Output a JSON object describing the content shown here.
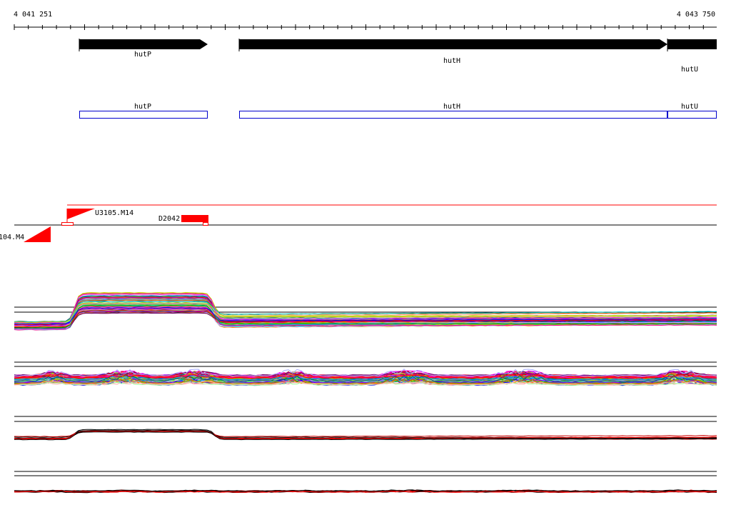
{
  "coordinates": {
    "start_label": "4 041 251",
    "end_label": "4 043 750"
  },
  "genes": [
    {
      "label": "hutP",
      "color": "#000000"
    },
    {
      "label": "hutH",
      "color": "#000000"
    },
    {
      "label": "hutU",
      "color": "#000000"
    }
  ],
  "gene_boxes": [
    {
      "label": "hutP",
      "color": "#0000cc"
    },
    {
      "label": "hutH",
      "color": "#0000cc"
    },
    {
      "label": "hutU",
      "color": "#0000cc"
    }
  ],
  "promoters": [
    {
      "label": "U3105.M14",
      "color": "#ff0000"
    },
    {
      "label": "D2042",
      "color": "#ff0000"
    },
    {
      "label": "104.M4",
      "color": "#ff0000"
    }
  ],
  "expression_tracks": [
    {
      "name": "tiling-track-1"
    },
    {
      "name": "tiling-track-2"
    },
    {
      "name": "tiling-track-3"
    },
    {
      "name": "tiling-track-4"
    }
  ],
  "palette": [
    "#ff0000",
    "#00aa00",
    "#0000ff",
    "#ff00ff",
    "#00cccc",
    "#cccc00",
    "#ff8800",
    "#8800ff",
    "#888888",
    "#0088ff",
    "#ff0088",
    "#88cc00",
    "#cc6600",
    "#006666",
    "#660066",
    "#99ff99",
    "#ffaaaa",
    "#aaaaff"
  ]
}
